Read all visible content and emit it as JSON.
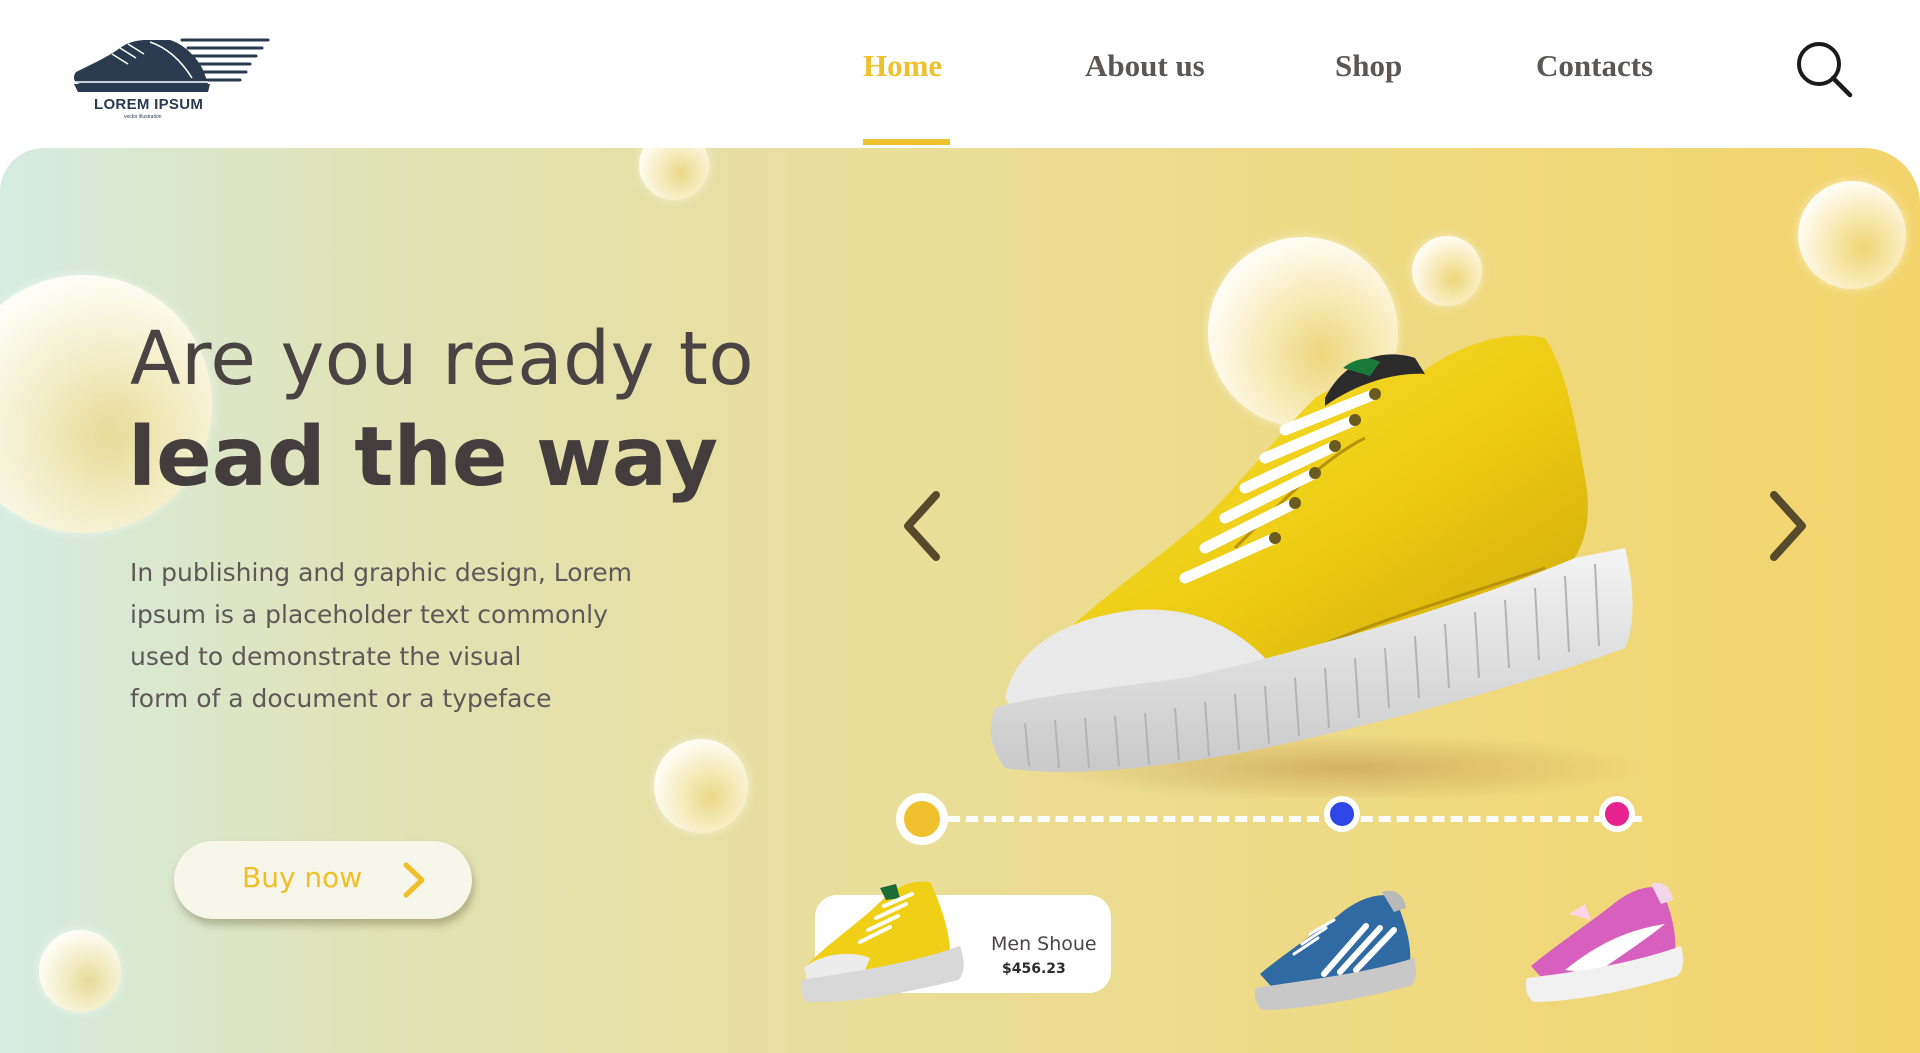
{
  "brand": {
    "name": "LOREM IPSUM",
    "tagline": "vector illustration",
    "icon": "running-shoe-logo"
  },
  "nav": {
    "items": [
      {
        "label": "Home",
        "active": true
      },
      {
        "label": "About us",
        "active": false
      },
      {
        "label": "Shop",
        "active": false
      },
      {
        "label": "Contacts",
        "active": false
      }
    ],
    "search_icon": "search-icon",
    "active_color": "#eec12d",
    "text_color": "#5c5656"
  },
  "hero": {
    "headline_line1": "Are you ready to",
    "headline_line2": "lead the way",
    "description_lines": [
      "In publishing and graphic design, Lorem",
      "ipsum is a placeholder text commonly",
      "used to demonstrate the visual",
      "form of a document or a typeface"
    ],
    "cta_label": "Buy now",
    "cta_icon": "chevron-right-icon",
    "prev_icon": "chevron-left-icon",
    "next_icon": "chevron-right-icon",
    "gradient_colors": [
      "#d5ece1",
      "#e9de9b",
      "#f3d46b"
    ]
  },
  "carousel": {
    "dots": [
      {
        "color": "#eec12d",
        "selected": true
      },
      {
        "color": "#2f46e6",
        "selected": false
      },
      {
        "color": "#e7218f",
        "selected": false
      }
    ],
    "products": [
      {
        "name": "Men Shoue",
        "price": "$456.23",
        "color": "#f2d118",
        "selected": true
      },
      {
        "name": "",
        "price": "",
        "color": "#2f6aa3",
        "selected": false
      },
      {
        "name": "",
        "price": "",
        "color": "#d75fbd",
        "selected": false
      }
    ]
  }
}
